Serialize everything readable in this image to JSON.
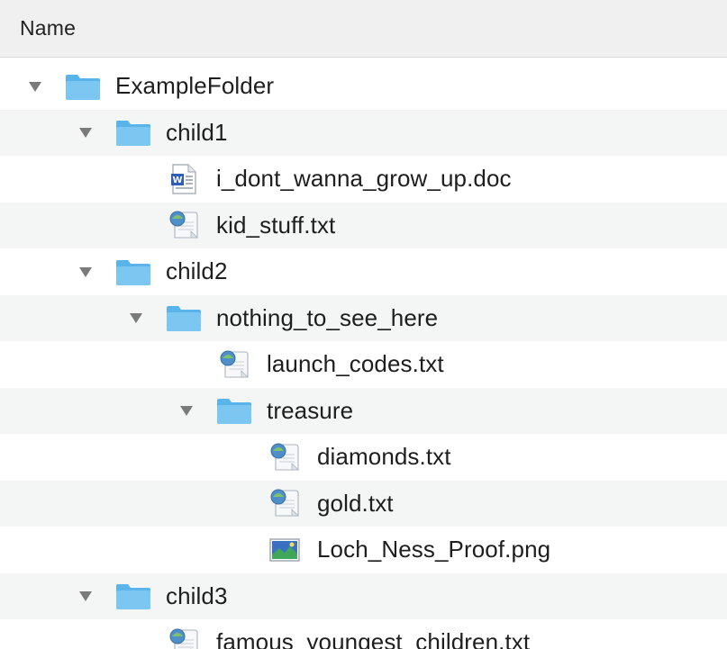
{
  "header": {
    "name_label": "Name"
  },
  "rows": [
    {
      "label": "ExampleFolder",
      "type": "folder",
      "depth": 0,
      "expanded": true
    },
    {
      "label": "child1",
      "type": "folder",
      "depth": 1,
      "expanded": true
    },
    {
      "label": "i_dont_wanna_grow_up.doc",
      "type": "doc",
      "depth": 2
    },
    {
      "label": "kid_stuff.txt",
      "type": "txt",
      "depth": 2
    },
    {
      "label": "child2",
      "type": "folder",
      "depth": 1,
      "expanded": true
    },
    {
      "label": "nothing_to_see_here",
      "type": "folder",
      "depth": 2,
      "expanded": true
    },
    {
      "label": "launch_codes.txt",
      "type": "txt",
      "depth": 3
    },
    {
      "label": "treasure",
      "type": "folder",
      "depth": 3,
      "expanded": true
    },
    {
      "label": "diamonds.txt",
      "type": "txt",
      "depth": 4
    },
    {
      "label": "gold.txt",
      "type": "txt",
      "depth": 4
    },
    {
      "label": "Loch_Ness_Proof.png",
      "type": "png",
      "depth": 4
    },
    {
      "label": "child3",
      "type": "folder",
      "depth": 1,
      "expanded": true
    },
    {
      "label": "famous_youngest_children.txt",
      "type": "txt",
      "depth": 2
    }
  ],
  "icons": {
    "folder": "folder-icon",
    "doc": "word-document-icon",
    "txt": "text-document-icon",
    "png": "image-file-icon",
    "disclosure": "disclosure-triangle-down-icon"
  },
  "colors": {
    "folder": "#5ab4ec",
    "folder_tab": "#7cc6f2",
    "alt_row": "#f4f5f5",
    "header_bg": "#f0f0f0"
  }
}
